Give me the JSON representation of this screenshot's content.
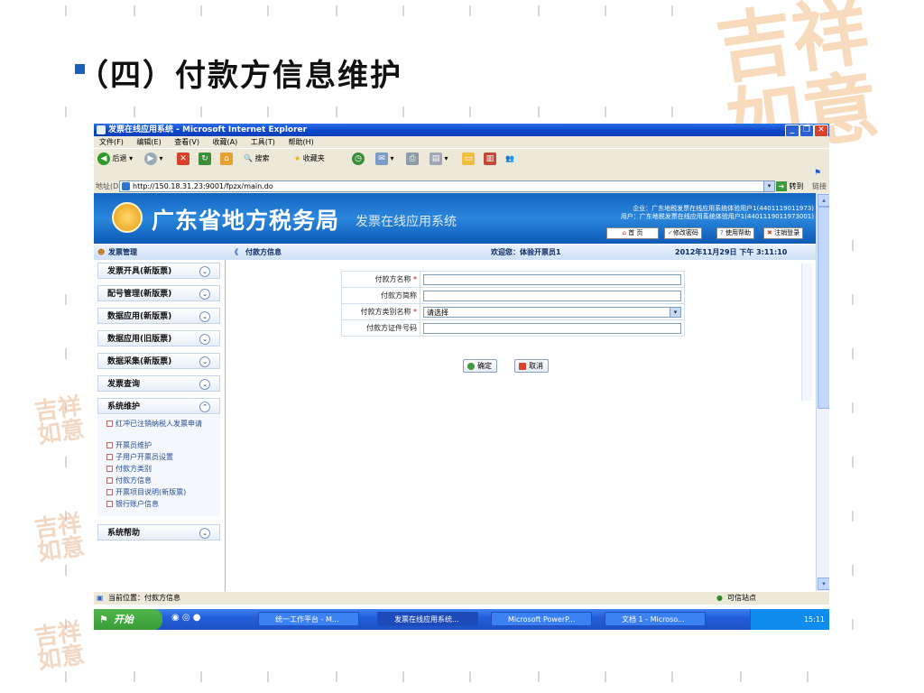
{
  "slide": {
    "title": "（四）付款方信息维护"
  },
  "window": {
    "title": "发票在线应用系统 - Microsoft Internet Explorer",
    "menu": [
      "文件(F)",
      "编辑(E)",
      "查看(V)",
      "收藏(A)",
      "工具(T)",
      "帮助(H)"
    ],
    "toolbar": {
      "back": "后退",
      "search": "搜索",
      "favorites": "收藏夹"
    },
    "address": {
      "label": "地址(D)",
      "url": "http://150.18.31.23:9001/fpzx/main.do",
      "go": "转到",
      "links": "链接"
    }
  },
  "banner": {
    "title": "广东省地方税务局",
    "subtitle": "发票在线应用系统",
    "info1": "企业：广东地税发票在线应用系统体验用户1(4401119011973)",
    "info2": "用户：广东地税发票在线应用系统体验用户1(4401119011973001)",
    "buttons": [
      "首 页",
      "修改密码",
      "使用帮助",
      "注销登录"
    ]
  },
  "nav": {
    "left_title": "发票管理",
    "page_title": "付款方信息",
    "welcome": "欢迎您：体验开票员1",
    "datetime": "2012年11月29日 下午 3:11:10"
  },
  "sidebar": {
    "sections": [
      "发票开具(新版票)",
      "配号管理(新版票)",
      "数据应用(新版票)",
      "数据应用(旧版票)",
      "数据采集(新版票)",
      "发票查询",
      "系统维护",
      "系统帮助"
    ],
    "subitems": [
      "红冲已注销纳税人发票申请",
      "开票员维护",
      "子用户开票员设置",
      "付款方类别",
      "付款方信息",
      "开票项目说明(新版票)",
      "银行账户信息"
    ]
  },
  "form": {
    "fields": [
      {
        "label": "付款方名称",
        "required": true,
        "value": ""
      },
      {
        "label": "付款方简称",
        "required": false,
        "value": ""
      },
      {
        "label": "付款方类别名称",
        "required": true,
        "value": "请选择"
      },
      {
        "label": "付款方证件号码",
        "required": false,
        "value": ""
      }
    ],
    "confirm": "确定",
    "cancel": "取消"
  },
  "status": {
    "location": "当前位置：付款方信息",
    "zone": "可信站点"
  },
  "taskbar": {
    "start": "开始",
    "tasks": [
      "统一工作平台 - M...",
      "发票在线应用系统...",
      "Microsoft PowerP...",
      "文档 1 - Microso..."
    ],
    "clock": "15:11"
  }
}
